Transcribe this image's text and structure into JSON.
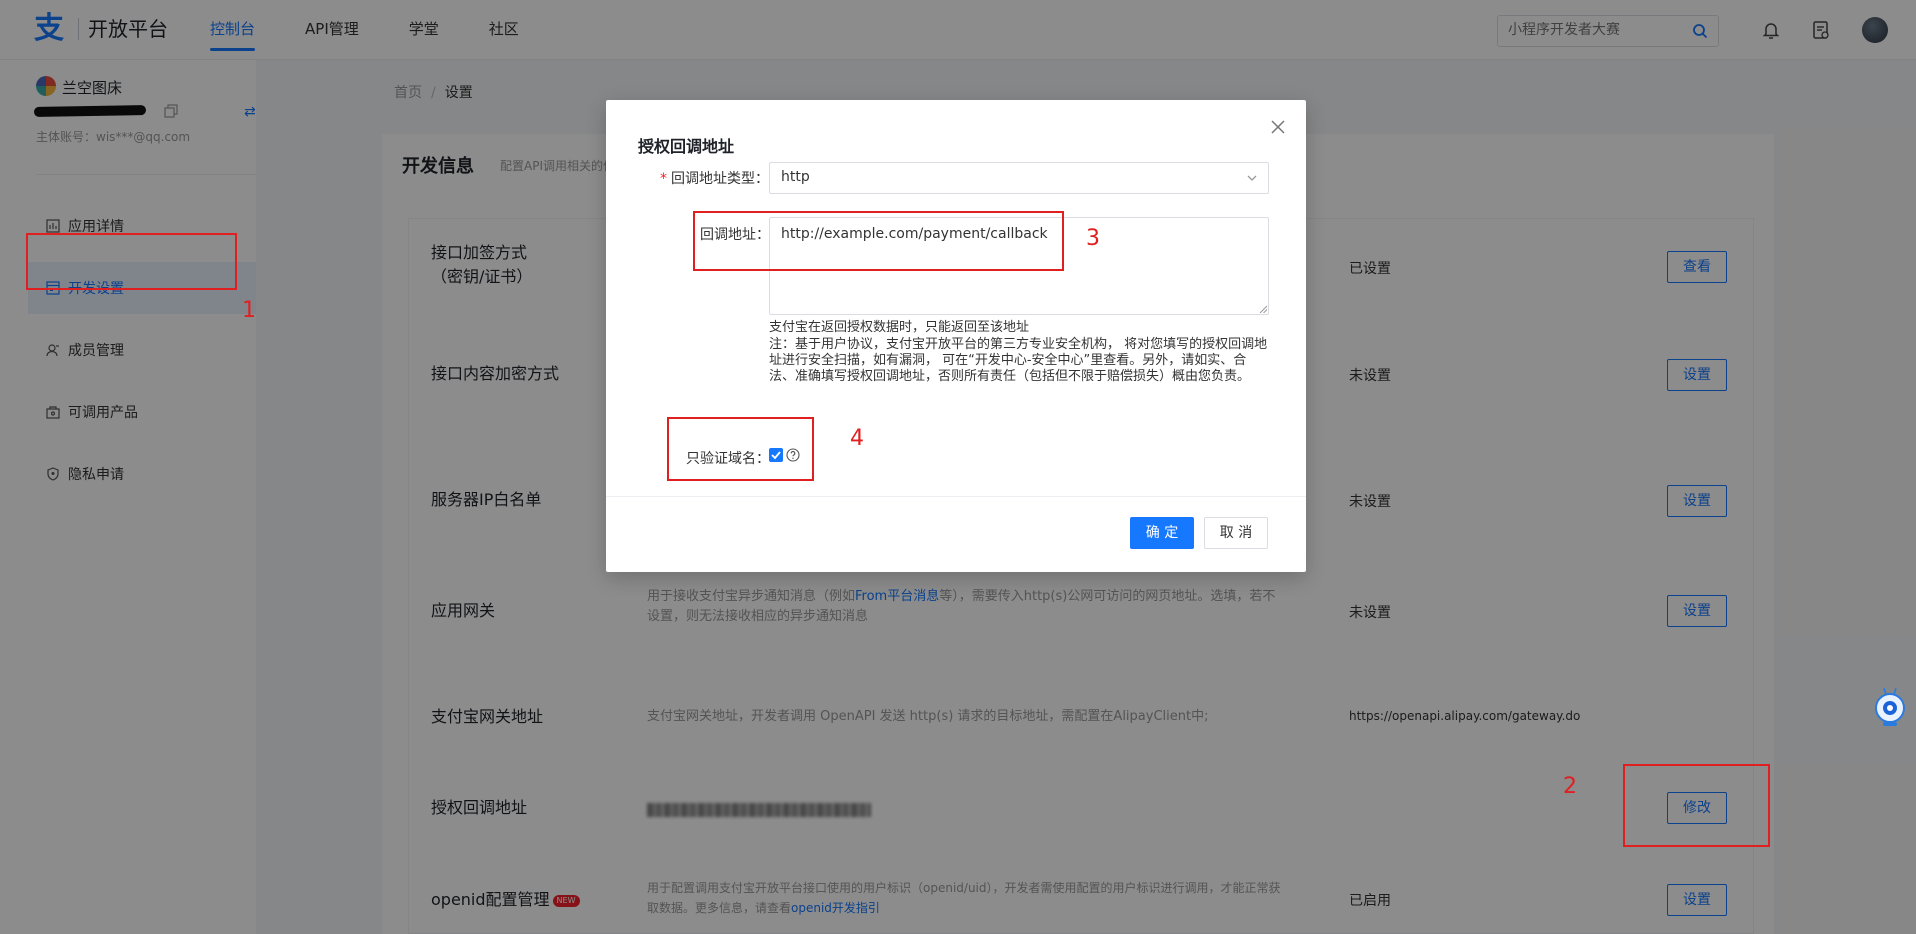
{
  "header": {
    "logo_text": "开放平台",
    "nav": [
      "控制台",
      "API管理",
      "学堂",
      "社区"
    ],
    "active_nav": 0,
    "search_placeholder": "小程序开发者大赛"
  },
  "sidebar": {
    "app_name": "兰空图床",
    "account": "主体账号：wis***@qq.com",
    "items": [
      {
        "label": "应用详情",
        "icon": "chart-icon"
      },
      {
        "label": "开发设置",
        "icon": "dev-settings-icon"
      },
      {
        "label": "成员管理",
        "icon": "members-icon"
      },
      {
        "label": "可调用产品",
        "icon": "products-icon"
      },
      {
        "label": "隐私申请",
        "icon": "privacy-shield-icon"
      }
    ],
    "active_index": 1
  },
  "breadcrumb": {
    "home": "首页",
    "separator": "/",
    "current": "设置"
  },
  "panel": {
    "title": "开发信息",
    "desc": "配置API调用相关的信"
  },
  "rows": [
    {
      "name_line1": "接口加签方式",
      "name_line2": "（密钥/证书）",
      "status": "已设置",
      "button": "查看"
    },
    {
      "name": "接口内容加密方式",
      "status": "未设置",
      "button": "设置"
    },
    {
      "name": "服务器IP白名单",
      "status": "未设置",
      "button": "设置"
    },
    {
      "name": "应用网关",
      "desc_pre": "用于接收支付宝异步通知消息（例如",
      "desc_link": "From平台消息",
      "desc_post": "等），需要传入http(s)公网可访问的网页地址。选填，若不设置，则无法接收相应的异步通知消息",
      "status": "未设置",
      "button": "设置"
    },
    {
      "name": "支付宝网关地址",
      "desc": "支付宝网关地址，开发者调用 OpenAPI 发送 http(s) 请求的目标地址，需配置在AlipayClient中;",
      "status": "https://openapi.alipay.com/gateway.do"
    },
    {
      "name": "授权回调地址",
      "button": "修改"
    },
    {
      "name": "openid配置管理",
      "badge": "NEW",
      "desc_pre": "用于配置调用支付宝开放平台接口使用的用户标识（openid/uid），开发者需使用配置的用户标识进行调用，才能正常获取数据。更多信息，请查看",
      "desc_link": "openid开发指引",
      "status": "已启用",
      "button": "设置"
    }
  ],
  "modal": {
    "title": "授权回调地址",
    "type_label": "回调地址类型：",
    "required_mark": "*",
    "type_value": "http",
    "url_label": "回调地址：",
    "url_value": "http://example.com/payment/callback",
    "hint1": "支付宝在返回授权数据时，只能返回至该地址",
    "hint2": "注：基于用户协议，支付宝开放平台的第三方专业安全机构， 将对您填写的授权回调地址进行安全扫描，如有漏洞， 可在“开发中心-安全中心”里查看。另外，请如实、合法、准确填写授权回调地址，否则所有责任（包括但不限于赔偿损失）概由您负责。",
    "domain_only_label": "只验证域名：",
    "domain_only_checked": true,
    "ok": "确 定",
    "cancel": "取 消"
  },
  "annotations": [
    "1",
    "2",
    "3",
    "4"
  ],
  "colors": {
    "brand": "#1677ff",
    "annotation": "#e02020"
  }
}
